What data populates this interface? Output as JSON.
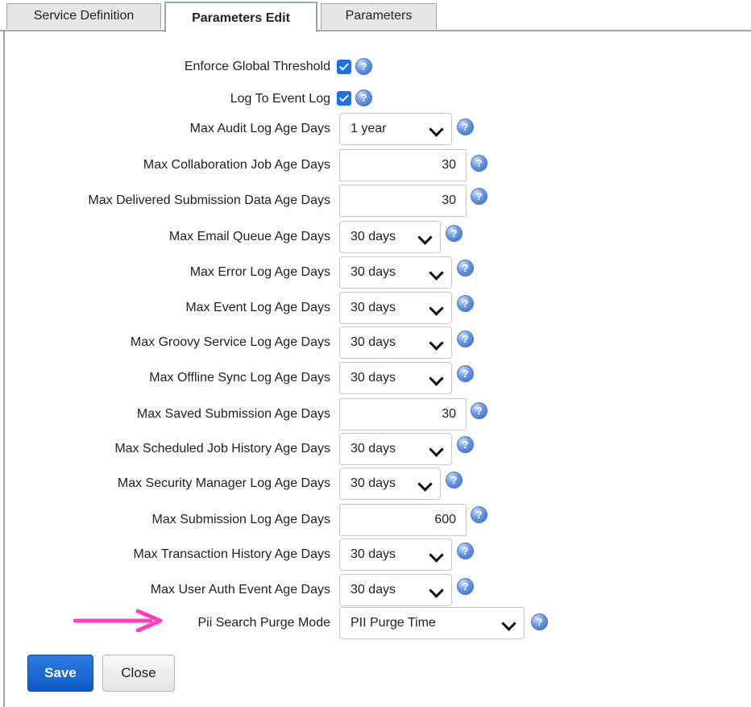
{
  "tabs": [
    {
      "label": "Service Definition"
    },
    {
      "label": "Parameters Edit"
    },
    {
      "label": "Parameters"
    }
  ],
  "params": [
    {
      "label": "Enforce Global Threshold",
      "type": "checkbox",
      "checked": true
    },
    {
      "label": "Log To Event Log",
      "type": "checkbox",
      "checked": true
    },
    {
      "label": "Max Audit Log Age Days",
      "type": "select",
      "value": "1 year"
    },
    {
      "label": "Max Collaboration Job Age Days",
      "type": "text",
      "value": "30"
    },
    {
      "label": "Max Delivered Submission Data Age Days",
      "type": "text",
      "value": "30"
    },
    {
      "label": "Max Email Queue Age Days",
      "type": "select",
      "value": "30 days"
    },
    {
      "label": "Max Error Log Age Days",
      "type": "select",
      "value": "30 days"
    },
    {
      "label": "Max Event Log Age Days",
      "type": "select",
      "value": "30 days"
    },
    {
      "label": "Max Groovy Service Log Age Days",
      "type": "select",
      "value": "30 days"
    },
    {
      "label": "Max Offline Sync Log Age Days",
      "type": "select",
      "value": "30 days"
    },
    {
      "label": "Max Saved Submission Age Days",
      "type": "text",
      "value": "30"
    },
    {
      "label": "Max Scheduled Job History Age Days",
      "type": "select",
      "value": "30 days"
    },
    {
      "label": "Max Security Manager Log Age Days",
      "type": "select",
      "value": "30 days"
    },
    {
      "label": "Max Submission Log Age Days",
      "type": "text",
      "value": "600"
    },
    {
      "label": "Max Transaction History Age Days",
      "type": "select",
      "value": "30 days"
    },
    {
      "label": "Max User Auth Event Age Days",
      "type": "select",
      "value": "30 days"
    },
    {
      "label": "Pii Search Purge Mode",
      "type": "select",
      "value": "PII Purge Time"
    }
  ],
  "help_icon_glyph": "?",
  "buttons": {
    "save": "Save",
    "close": "Close"
  },
  "colors": {
    "accent": "#1a73e8",
    "arrow": "#ff3fbf",
    "tab_border": "#9aa6b5"
  }
}
